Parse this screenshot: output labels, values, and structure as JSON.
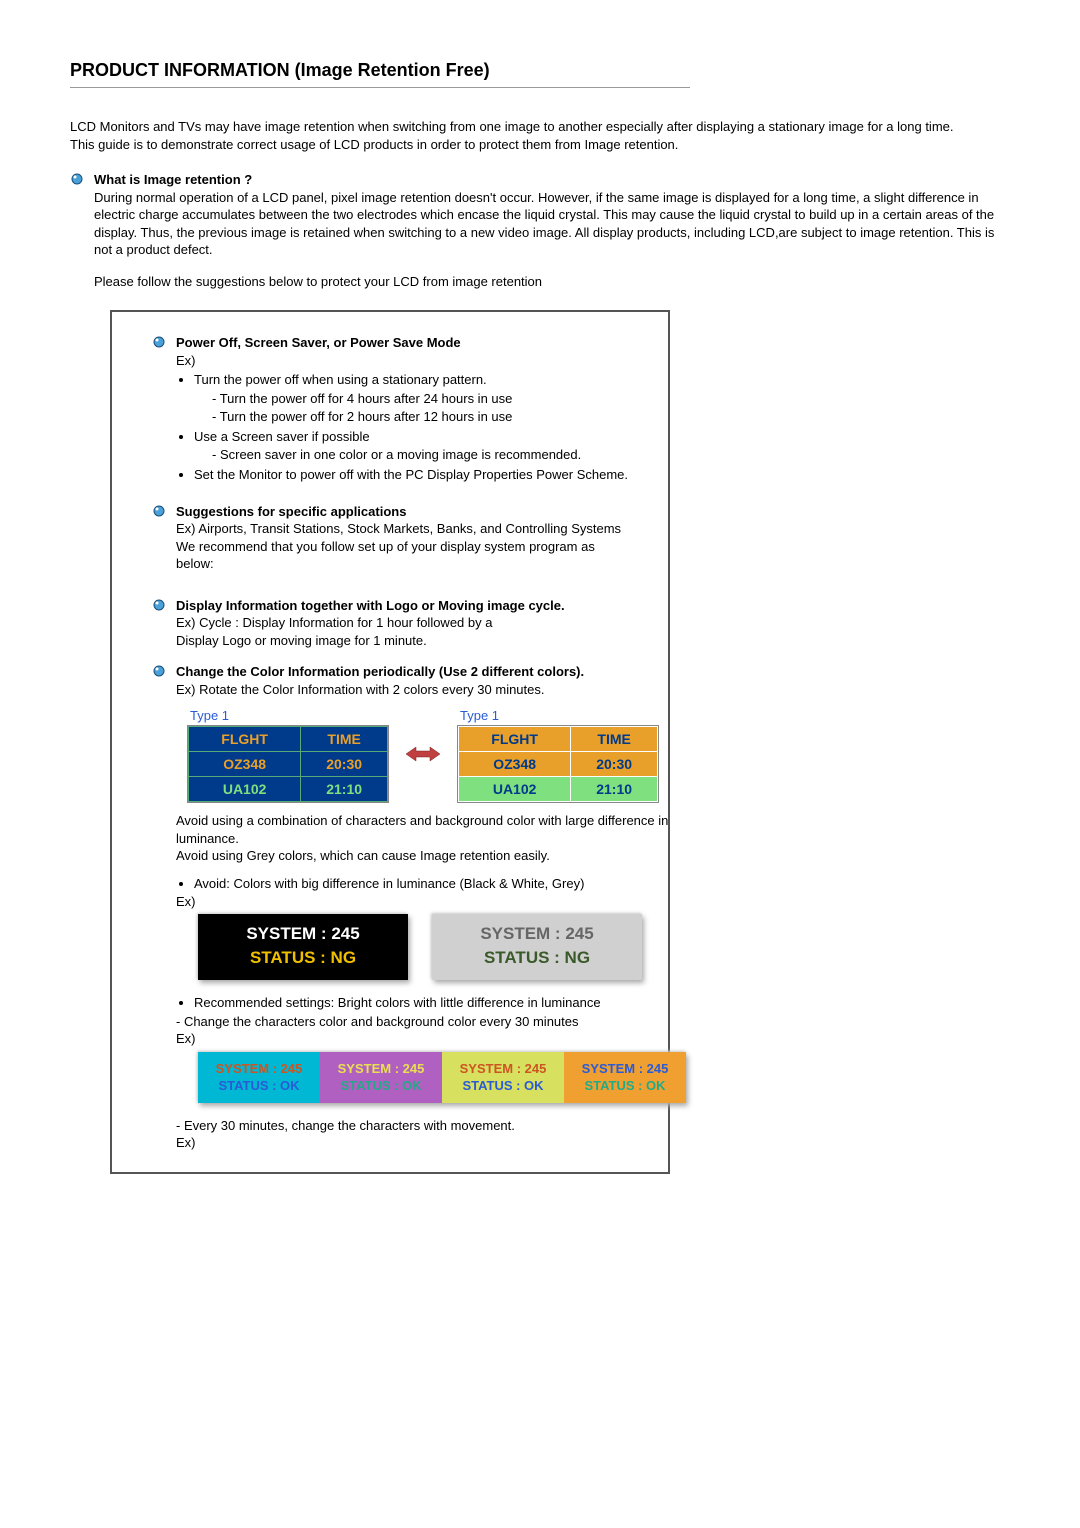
{
  "title": "PRODUCT INFORMATION (Image Retention Free)",
  "intro": {
    "p1": "LCD Monitors and TVs may have image retention when switching from one image to another especially after displaying a stationary image for a long time.",
    "p2": "This guide is to demonstrate correct usage of LCD products in order to protect them from Image retention."
  },
  "sec1": {
    "heading": "What is Image retention ?",
    "body": "During normal operation of a LCD panel, pixel image retention doesn't occur. However, if the same image is displayed for a long time, a slight difference in electric charge accumulates between the two electrodes which encase the liquid crystal. This may cause the liquid crystal to build up in a certain areas of the display. Thus, the previous image is retained when switching to a new video image. All display products, including LCD,are subject to image retention. This is not a product defect.",
    "follow": "Please follow the suggestions below to protect your LCD from image retention"
  },
  "box": {
    "a": {
      "heading": "Power Off, Screen Saver, or Power Save Mode",
      "ex": "Ex)",
      "li1": "Turn the power off when using a stationary pattern.",
      "li1a": "- Turn the power off for 4 hours after 24 hours in use",
      "li1b": "- Turn the power off for 2 hours after 12 hours in use",
      "li2": "Use a Screen saver if possible",
      "li2a": "- Screen saver in one color or a moving image is recommended.",
      "li3": "Set the Monitor to power off with the PC Display Properties Power Scheme."
    },
    "b": {
      "heading": "Suggestions for specific applications",
      "l1": "Ex) Airports, Transit Stations, Stock Markets, Banks, and Controlling Systems",
      "l2": "We recommend that you follow set up of your display system program as below:"
    },
    "c": {
      "heading": "Display Information together with Logo or Moving image cycle.",
      "l1": "Ex) Cycle : Display Information for 1 hour followed by a",
      "l2": "Display Logo or moving image for 1 minute."
    },
    "d": {
      "heading": "Change the Color Information periodically (Use 2 different colors).",
      "l1": "Ex) Rotate the Color Information with 2 colors every 30 minutes."
    },
    "flight": {
      "typeLabel": "Type 1",
      "h1": "FLGHT",
      "h2": "TIME",
      "r1c1": "OZ348",
      "r1c2": "20:30",
      "r2c1": "UA102",
      "r2c2": "21:10"
    },
    "avoid": {
      "p1": "Avoid using a combination of characters and background color with large difference in luminance.",
      "p2": "Avoid using Grey colors, which can cause Image retention easily.",
      "li1": "Avoid: Colors with big difference in luminance (Black & White, Grey)",
      "ex": "Ex)"
    },
    "sys": {
      "l1": "SYSTEM : 245",
      "l2": "STATUS : NG"
    },
    "rec": {
      "li1": "Recommended settings: Bright colors with little difference in luminance",
      "l1": "- Change the characters color and background color every 30 minutes",
      "ex": "Ex)"
    },
    "quad": {
      "l1": "SYSTEM : 245",
      "l2": "STATUS : OK"
    },
    "tail": {
      "l1": "- Every 30 minutes, change the characters with movement.",
      "ex": "Ex)"
    }
  }
}
